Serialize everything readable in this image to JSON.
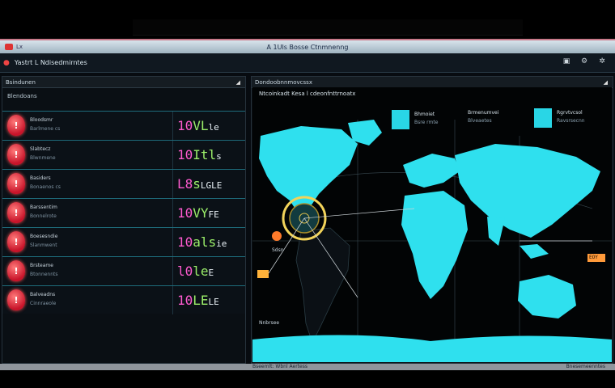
{
  "window": {
    "title": "A 1UIs Bosse Ctnmnenng",
    "logo_text": "Lx",
    "accent_color": "#29d6e6",
    "alert_color": "#c8142a"
  },
  "header": {
    "title": "Yastrt L Ndisedmirntes",
    "tools": [
      "window-icon",
      "settings-icon",
      "gear-icon"
    ]
  },
  "left_panel": {
    "title": "Bsindunen",
    "subtitle": "Blendoans",
    "alerts": [
      {
        "line1": "Bloodsmr",
        "line2": "Barlmene cs",
        "value_a": "10",
        "value_b": "VL",
        "value_c": "le"
      },
      {
        "line1": "Slabtecz",
        "line2": "Blwnmene",
        "value_a": "10",
        "value_b": "Itl",
        "value_c": "s"
      },
      {
        "line1": "Basiders",
        "line2": "Bonaenos cs",
        "value_a": "L8",
        "value_b": "s",
        "value_c": "LGLE"
      },
      {
        "line1": "Barssentim",
        "line2": "Bonnelrote",
        "value_a": "10",
        "value_b": "VY",
        "value_c": "FE"
      },
      {
        "line1": "Boesesndie",
        "line2": "Slanmwent",
        "value_a": "10",
        "value_b": "als",
        "value_c": "ie"
      },
      {
        "line1": "Brsteame",
        "line2": "Btonnennts",
        "value_a": "l0",
        "value_b": "le",
        "value_c": "E"
      },
      {
        "line1": "Balveadns",
        "line2": "Cinnraeole",
        "value_a": "10",
        "value_b": "LE",
        "value_c": "LE"
      }
    ]
  },
  "right_panel": {
    "title": "Dondoobnnmovcssx",
    "caption": "Ntcoinkadt Kesa l cdeonfnttrnoatx",
    "stats": [
      {
        "t1": "Bhmoiet",
        "t2": "Bsre rmte"
      },
      {
        "t1": "Brmenumvei",
        "t2": "Blveaetes"
      },
      {
        "t1": "Rgrvtvcsol",
        "t2": "Ravsrsecnn"
      }
    ],
    "marker_label": "Sdsn",
    "coordinate_readout": "EOY",
    "bottom_label": "Nnbrsee"
  },
  "footer": {
    "status": "Bseemlt: Wbnl Aertess",
    "status_right": "Bnesemeenntes"
  },
  "icons": {
    "app_logo": "app-logo-icon",
    "collapse": "collapse-icon",
    "alert_badge": "alert-badge-icon"
  }
}
